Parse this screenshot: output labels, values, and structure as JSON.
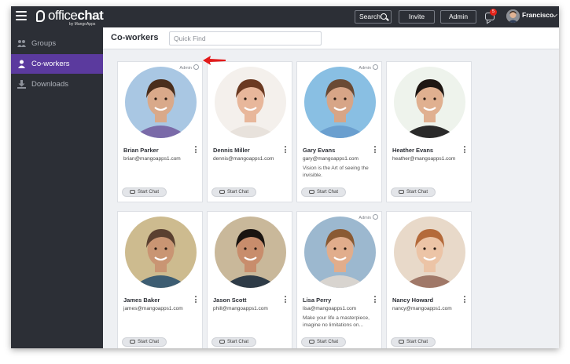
{
  "app": {
    "logo_main": "office",
    "logo_bold": "chat",
    "logo_sub": "by MangoApps",
    "search_label": "Search",
    "invite_label": "Invite",
    "admin_label": "Admin",
    "notification_count": "5",
    "user_name": "Francisco"
  },
  "sidebar": {
    "items": [
      {
        "label": "Groups",
        "icon": "groups-icon",
        "active": false
      },
      {
        "label": "Co-workers",
        "icon": "user-icon",
        "active": true
      },
      {
        "label": "Downloads",
        "icon": "download-icon",
        "active": false
      }
    ]
  },
  "main": {
    "title": "Co-workers",
    "search_placeholder": "Quick Find",
    "start_chat_label": "Start Chat",
    "admin_tag": "Admin",
    "coworkers": [
      {
        "name": "Brian Parker",
        "email": "brian@mangoapps1.com",
        "status": "",
        "admin": true,
        "skin": "#d9a98a",
        "hair": "#4a2e1c",
        "bg": "#a9c7e3",
        "shirt": "#7a6aa8"
      },
      {
        "name": "Dennis Miller",
        "email": "dennis@mangoapps1.com",
        "status": "",
        "admin": false,
        "skin": "#e8b79b",
        "hair": "#6b3a22",
        "bg": "#f4f0ec",
        "shirt": "#e8e2dc"
      },
      {
        "name": "Gary Evans",
        "email": "gary@mangoapps1.com",
        "status": "Vision is the Art of seeing the invisible.",
        "admin": true,
        "skin": "#d7a587",
        "hair": "#6a4a34",
        "bg": "#89bfe3",
        "shirt": "#6a9fcf"
      },
      {
        "name": "Heather Evans",
        "email": "heather@mangoapps1.com",
        "status": "",
        "admin": false,
        "skin": "#e0b090",
        "hair": "#1e1612",
        "bg": "#eef3ec",
        "shirt": "#2a2a2a"
      },
      {
        "name": "James Baker",
        "email": "james@mangoapps1.com",
        "status": "",
        "admin": false,
        "skin": "#c99573",
        "hair": "#5a4030",
        "bg": "#cdbb8f",
        "shirt": "#3d5d72"
      },
      {
        "name": "Jason Scott",
        "email": "phill@mangoapps1.com",
        "status": "",
        "admin": false,
        "skin": "#c88d6c",
        "hair": "#1a1410",
        "bg": "#c9b89a",
        "shirt": "#2e3b47"
      },
      {
        "name": "Lisa Perry",
        "email": "lisa@mangoapps1.com",
        "status": "Make your life a masterpiece, imagine no limitations on...",
        "admin": true,
        "skin": "#e1ad8c",
        "hair": "#8a5a33",
        "bg": "#9cb8cf",
        "shirt": "#d8d4cf"
      },
      {
        "name": "Nancy Howard",
        "email": "nancy@mangoapps1.com",
        "status": "",
        "admin": false,
        "skin": "#ecc4a6",
        "hair": "#b46a3a",
        "bg": "#e8d9c9",
        "shirt": "#a07868"
      }
    ]
  }
}
